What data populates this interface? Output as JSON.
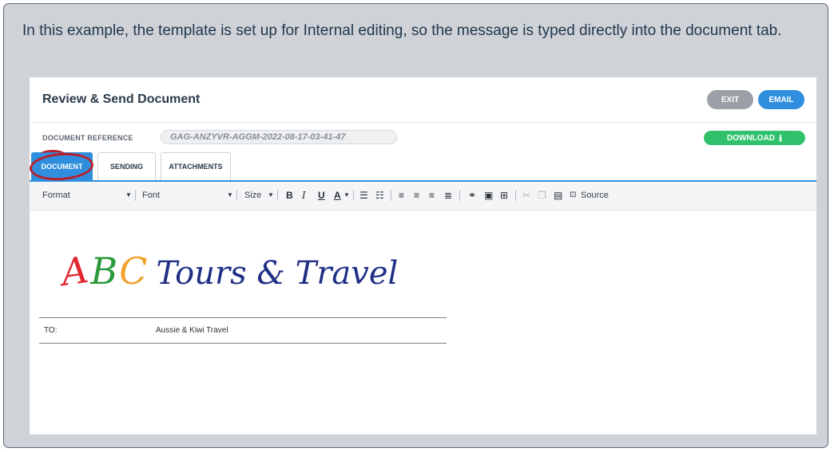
{
  "intro_text": "In this example, the template is set up for Internal editing, so the message is typed directly into the document tab.",
  "header": {
    "title": "Review & Send Document",
    "exit_label": "EXIT",
    "email_label": "EMAIL"
  },
  "reference": {
    "label": "DOCUMENT REFERENCE",
    "value": "GAG-ANZYVR-AGGM-2022-08-17-03-41-47",
    "download_label": "DOWNLOAD"
  },
  "tabs": [
    {
      "label": "DOCUMENT",
      "active": true
    },
    {
      "label": "SENDING",
      "active": false
    },
    {
      "label": "ATTACHMENTS",
      "active": false
    }
  ],
  "toolbar": {
    "format_label": "Format",
    "font_label": "Font",
    "size_label": "Size",
    "source_label": "Source",
    "icons": [
      "bold-icon",
      "italic-icon",
      "underline-icon",
      "text-color-icon",
      "numbered-list-icon",
      "bulleted-list-icon",
      "align-left-icon",
      "align-center-icon",
      "align-right-icon",
      "justify-icon",
      "link-icon",
      "image-icon",
      "table-icon",
      "cut-icon",
      "copy-icon",
      "paste-icon",
      "source-icon"
    ]
  },
  "logo": {
    "letter_a": "A",
    "letter_b": "B",
    "letter_c": "C",
    "rest": "Tours & Travel"
  },
  "recipient": {
    "label": "TO:",
    "value": "Aussie & Kiwi Travel"
  },
  "colors": {
    "accent": "#2f8fde",
    "download": "#2fc16b",
    "exit": "#9aa0a6",
    "annotation_ring": "#b8202c",
    "callout_border": "#5c6b80"
  }
}
